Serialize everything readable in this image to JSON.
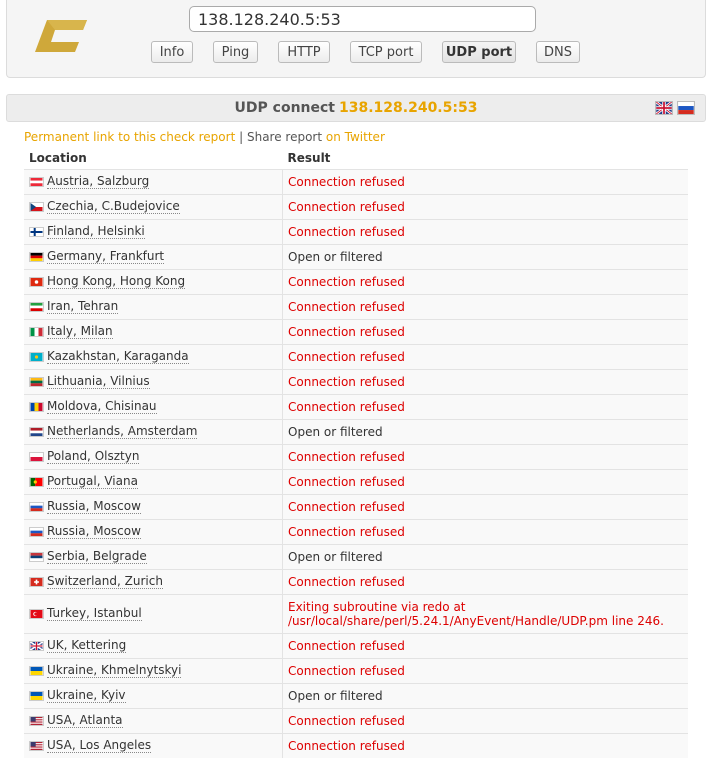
{
  "top": {
    "host_value": "138.128.240.5:53",
    "tools": [
      {
        "label": "Info",
        "active": false
      },
      {
        "label": "Ping",
        "active": false
      },
      {
        "label": "HTTP",
        "active": false
      },
      {
        "label": "TCP port",
        "active": false
      },
      {
        "label": "UDP port",
        "active": true
      },
      {
        "label": "DNS",
        "active": false
      }
    ]
  },
  "report": {
    "title_prefix": "UDP connect",
    "title_host": "138.128.240.5:53",
    "permalink_text": "Permanent link to this check report",
    "separator": "| Share report",
    "twitter_text": "on Twitter"
  },
  "table": {
    "col_location": "Location",
    "col_result": "Result",
    "rows": [
      {
        "flag": "austria",
        "location": "Austria, Salzburg",
        "result": "Connection refused",
        "status": "refused"
      },
      {
        "flag": "czechia",
        "location": "Czechia, C.Budejovice",
        "result": "Connection refused",
        "status": "refused"
      },
      {
        "flag": "finland",
        "location": "Finland, Helsinki",
        "result": "Connection refused",
        "status": "refused"
      },
      {
        "flag": "germany",
        "location": "Germany, Frankfurt",
        "result": "Open or filtered",
        "status": "open"
      },
      {
        "flag": "hongkong",
        "location": "Hong Kong, Hong Kong",
        "result": "Connection refused",
        "status": "refused"
      },
      {
        "flag": "iran",
        "location": "Iran, Tehran",
        "result": "Connection refused",
        "status": "refused"
      },
      {
        "flag": "italy",
        "location": "Italy, Milan",
        "result": "Connection refused",
        "status": "refused"
      },
      {
        "flag": "kazakhstan",
        "location": "Kazakhstan, Karaganda",
        "result": "Connection refused",
        "status": "refused"
      },
      {
        "flag": "lithuania",
        "location": "Lithuania, Vilnius",
        "result": "Connection refused",
        "status": "refused"
      },
      {
        "flag": "moldova",
        "location": "Moldova, Chisinau",
        "result": "Connection refused",
        "status": "refused"
      },
      {
        "flag": "netherlands",
        "location": "Netherlands, Amsterdam",
        "result": "Open or filtered",
        "status": "open"
      },
      {
        "flag": "poland",
        "location": "Poland, Olsztyn",
        "result": "Connection refused",
        "status": "refused"
      },
      {
        "flag": "portugal",
        "location": "Portugal, Viana",
        "result": "Connection refused",
        "status": "refused"
      },
      {
        "flag": "russia",
        "location": "Russia, Moscow",
        "result": "Connection refused",
        "status": "refused"
      },
      {
        "flag": "russia",
        "location": "Russia, Moscow",
        "result": "Connection refused",
        "status": "refused"
      },
      {
        "flag": "serbia",
        "location": "Serbia, Belgrade",
        "result": "Open or filtered",
        "status": "open"
      },
      {
        "flag": "switzerland",
        "location": "Switzerland, Zurich",
        "result": "Connection refused",
        "status": "refused"
      },
      {
        "flag": "turkey",
        "location": "Turkey, Istanbul",
        "result": "Exiting subroutine via redo at /usr/local/share/perl/5.24.1/AnyEvent/Handle/UDP.pm line 246.",
        "status": "refused",
        "tall": true
      },
      {
        "flag": "uk",
        "location": "UK, Kettering",
        "result": "Connection refused",
        "status": "refused"
      },
      {
        "flag": "ukraine",
        "location": "Ukraine, Khmelnytskyi",
        "result": "Connection refused",
        "status": "refused"
      },
      {
        "flag": "ukraine",
        "location": "Ukraine, Kyiv",
        "result": "Open or filtered",
        "status": "open"
      },
      {
        "flag": "usa",
        "location": "USA, Atlanta",
        "result": "Connection refused",
        "status": "refused"
      },
      {
        "flag": "usa",
        "location": "USA, Los Angeles",
        "result": "Connection refused",
        "status": "refused"
      }
    ]
  },
  "colors": {
    "accent": "#e8a400",
    "refused": "#dd0000",
    "logo": "#cfa83a"
  }
}
